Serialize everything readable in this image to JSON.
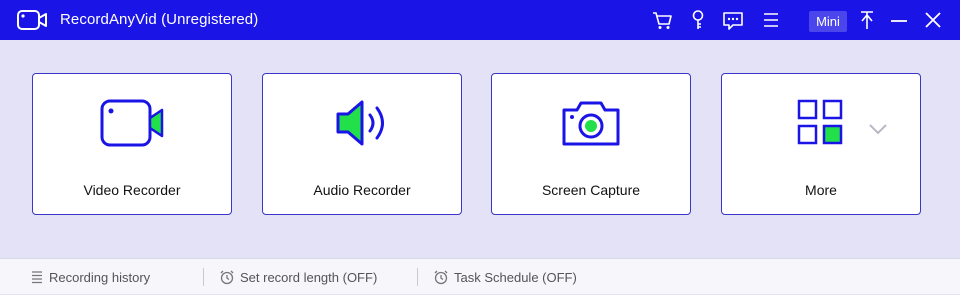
{
  "window": {
    "title": "RecordAnyVid (Unregistered)",
    "mini_label": "Mini"
  },
  "icons": {
    "app_logo": "camera-outline-icon",
    "cart": "cart-icon",
    "key": "key-icon",
    "feedback": "chat-bubble-icon",
    "menu": "hamburger-menu-icon",
    "pin": "pin-icon",
    "minimize": "minimize-icon",
    "close": "close-icon"
  },
  "cards": [
    {
      "label": "Video Recorder",
      "icon": "video-camera-icon"
    },
    {
      "label": "Audio Recorder",
      "icon": "speaker-icon"
    },
    {
      "label": "Screen Capture",
      "icon": "camera-icon"
    },
    {
      "label": "More",
      "icon": "grid-icon"
    }
  ],
  "statusbar": {
    "history": "Recording history",
    "record_length": "Set record length (OFF)",
    "schedule": "Task Schedule (OFF)"
  },
  "colors": {
    "titlebar": "#1a14e6",
    "accent_blue": "#1a14e6",
    "accent_green": "#22e04a",
    "background": "#e3e2f7"
  }
}
